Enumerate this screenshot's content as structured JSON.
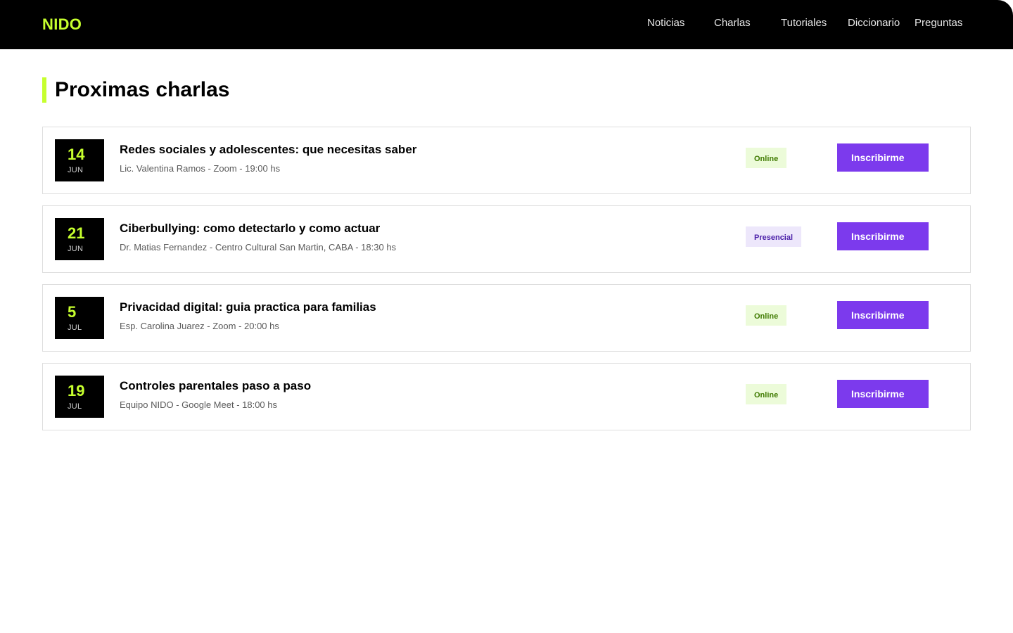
{
  "brand": {
    "logo_text": "NIDO"
  },
  "nav": {
    "items": [
      {
        "label": "Noticias"
      },
      {
        "label": "Charlas"
      },
      {
        "label": "Tutoriales"
      },
      {
        "label": "Diccionario"
      },
      {
        "label": "Preguntas"
      }
    ]
  },
  "main": {
    "title": "Proximas charlas",
    "events": [
      {
        "day": "14",
        "month": "JUN",
        "title": "Redes sociales y adolescentes: que necesitas saber",
        "meta": "Lic. Valentina Ramos - Zoom - 19:00 hs",
        "badge": "Online",
        "badge_kind": "online",
        "cta": "Inscribirme"
      },
      {
        "day": "21",
        "month": "JUN",
        "title": "Ciberbullying: como detectarlo y como actuar",
        "meta": "Dr. Matias Fernandez - Centro Cultural San Martin, CABA - 18:30 hs",
        "badge": "Presencial",
        "badge_kind": "presencial",
        "cta": "Inscribirme"
      },
      {
        "day": "5",
        "month": "JUL",
        "title": "Privacidad digital: guia practica para familias",
        "meta": "Esp. Carolina Juarez - Zoom - 20:00 hs",
        "badge": "Online",
        "badge_kind": "online",
        "cta": "Inscribirme"
      },
      {
        "day": "19",
        "month": "JUL",
        "title": "Controles parentales paso a paso",
        "meta": "Equipo NIDO - Google Meet - 18:00 hs",
        "badge": "Online",
        "badge_kind": "online",
        "cta": "Inscribirme"
      }
    ]
  },
  "colors": {
    "accent_lime": "#c6ff2e",
    "button_purple": "#7c3aed",
    "badge_online_bg": "#ecfbd9",
    "badge_online_text": "#3f7a00",
    "badge_presencial_bg": "#ede7fb",
    "badge_presencial_text": "#4a1fa8"
  }
}
